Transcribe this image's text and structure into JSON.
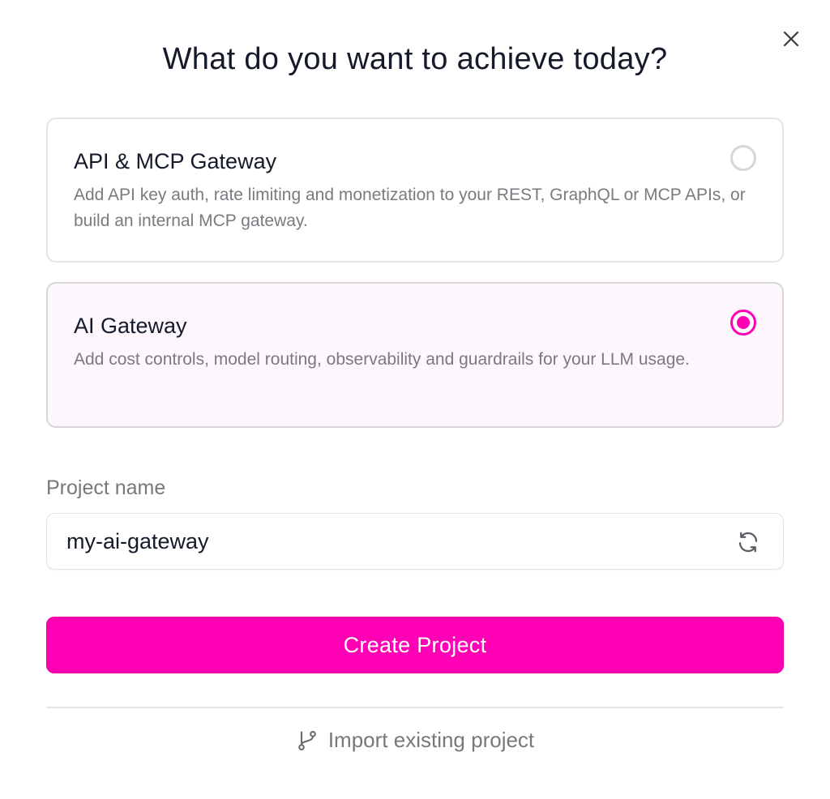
{
  "dialog": {
    "title": "What do you want to achieve today?",
    "close_icon": "close-icon"
  },
  "options": [
    {
      "title": "API & MCP Gateway",
      "description": "Add API key auth, rate limiting and monetization to your REST, GraphQL or MCP APIs, or build an internal MCP gateway.",
      "selected": false
    },
    {
      "title": "AI Gateway",
      "description": "Add cost controls, model routing, observability and guardrails for your LLM usage.",
      "selected": true
    }
  ],
  "project_name": {
    "label": "Project name",
    "value": "my-ai-gateway",
    "refresh_icon": "refresh-icon"
  },
  "actions": {
    "create_label": "Create Project",
    "import_label": "Import existing project",
    "import_icon": "git-branch-icon"
  },
  "colors": {
    "accent": "#ff00b4",
    "selected_card_bg": "#fdf6fc",
    "muted_text": "#77777d",
    "title_text": "#141a2a"
  }
}
